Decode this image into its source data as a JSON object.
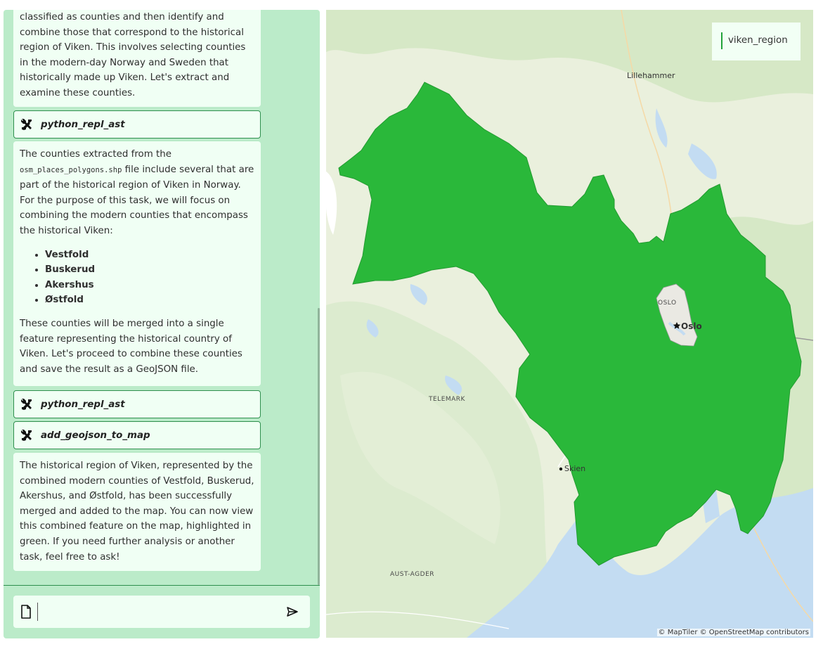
{
  "chat": {
    "messages": [
      {
        "type": "text",
        "text": "classified as counties and then identify and combine those that correspond to the historical region of Viken. This involves selecting counties in the modern-day Norway and Sweden that historically made up Viken. Let's extract and examine these counties."
      },
      {
        "type": "tool",
        "name": "python_repl_ast"
      },
      {
        "type": "text",
        "intro_before_code": "The counties extracted from the",
        "code": "osm_places_polygons.shp",
        "intro_after_code": "file include several that are part of the historical region of Viken in Norway. For the purpose of this task, we will focus on combining the modern counties that encompass the historical Viken:",
        "list": [
          "Vestfold",
          "Buskerud",
          "Akershus",
          "Østfold"
        ],
        "outro": "These counties will be merged into a single feature representing the historical country of Viken. Let's proceed to combine these counties and save the result as a GeoJSON file."
      },
      {
        "type": "tool",
        "name": "python_repl_ast"
      },
      {
        "type": "tool",
        "name": "add_geojson_to_map"
      },
      {
        "type": "text",
        "text": "The historical region of Viken, represented by the combined modern counties of Vestfold, Buskerud, Akershus, and Østfold, has been successfully merged and added to the map. You can now view this combined feature on the map, highlighted in green. If you need further analysis or another task, feel free to ask!"
      }
    ],
    "input": {
      "value": "",
      "placeholder": ""
    }
  },
  "map": {
    "legend": {
      "label": "viken_region",
      "color": "#22a23a"
    },
    "labels": {
      "lillehammer": "Lillehammer",
      "oslo_region": "OSLO",
      "oslo_city": "Oslo",
      "telemark": "TELEMARK",
      "skien": "Skien",
      "aust_agder": "AUST-AGDER"
    },
    "attribution": "© MapTiler © OpenStreetMap contributors",
    "colors": {
      "region_fill": "#2ab83a",
      "water": "#c3dcf2",
      "land": "#eaf0dd",
      "forest": "#d6e8c6"
    }
  },
  "icons": {
    "tool": "tools-icon",
    "attach": "file-icon",
    "send": "send-icon"
  }
}
